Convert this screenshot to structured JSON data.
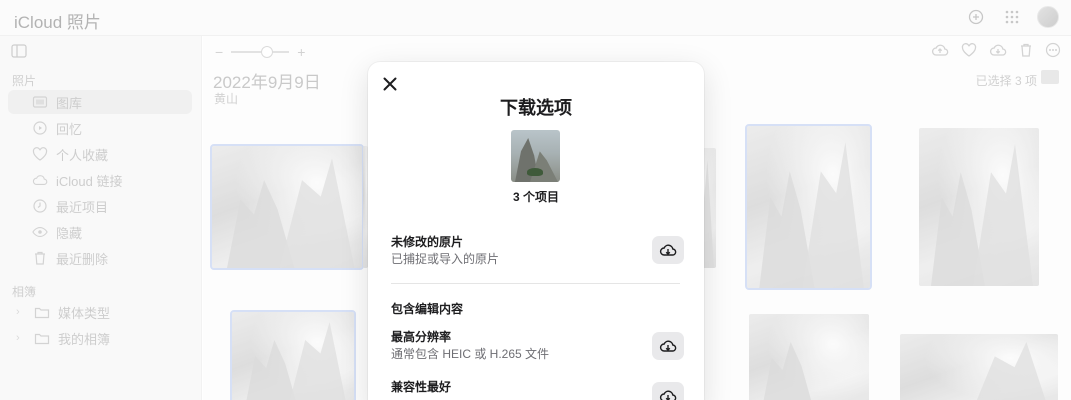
{
  "app": {
    "apple_glyph": "",
    "title": "iCloud 照片"
  },
  "sidebar": {
    "photos_section": "照片",
    "items": [
      {
        "label": "图库",
        "icon": "library-icon"
      },
      {
        "label": "回忆",
        "icon": "memories-icon"
      },
      {
        "label": "个人收藏",
        "icon": "heart-icon"
      },
      {
        "label": "iCloud 链接",
        "icon": "cloud-link-icon"
      },
      {
        "label": "最近项目",
        "icon": "clock-icon"
      },
      {
        "label": "隐藏",
        "icon": "eye-icon"
      },
      {
        "label": "最近删除",
        "icon": "trash-icon"
      }
    ],
    "albums_section": "相簿",
    "albums": [
      {
        "label": "媒体类型",
        "icon": "folder-icon"
      },
      {
        "label": "我的相簿",
        "icon": "folder-icon"
      }
    ]
  },
  "main": {
    "zoom_minus": "−",
    "zoom_plus": "+",
    "zoom_level": 0.5,
    "date_title": "2022年9月9日",
    "location": "黄山",
    "selection_count": "已选择 3 项"
  },
  "modal": {
    "close_glyph": "✕",
    "title": "下载选项",
    "count_label": "3 个项目",
    "unmodified": {
      "title": "未修改的原片",
      "subtitle": "已捕捉或导入的原片"
    },
    "edited_section": "包含编辑内容",
    "highest_res": {
      "title": "最高分辨率",
      "subtitle": "通常包含 HEIC 或 H.265 文件"
    },
    "most_compatible": {
      "title": "兼容性最好"
    }
  },
  "colors": {
    "accent_selection": "#c9d6f3",
    "download_icon": "#1d1d1f",
    "button_bg": "#e9e9eb"
  }
}
